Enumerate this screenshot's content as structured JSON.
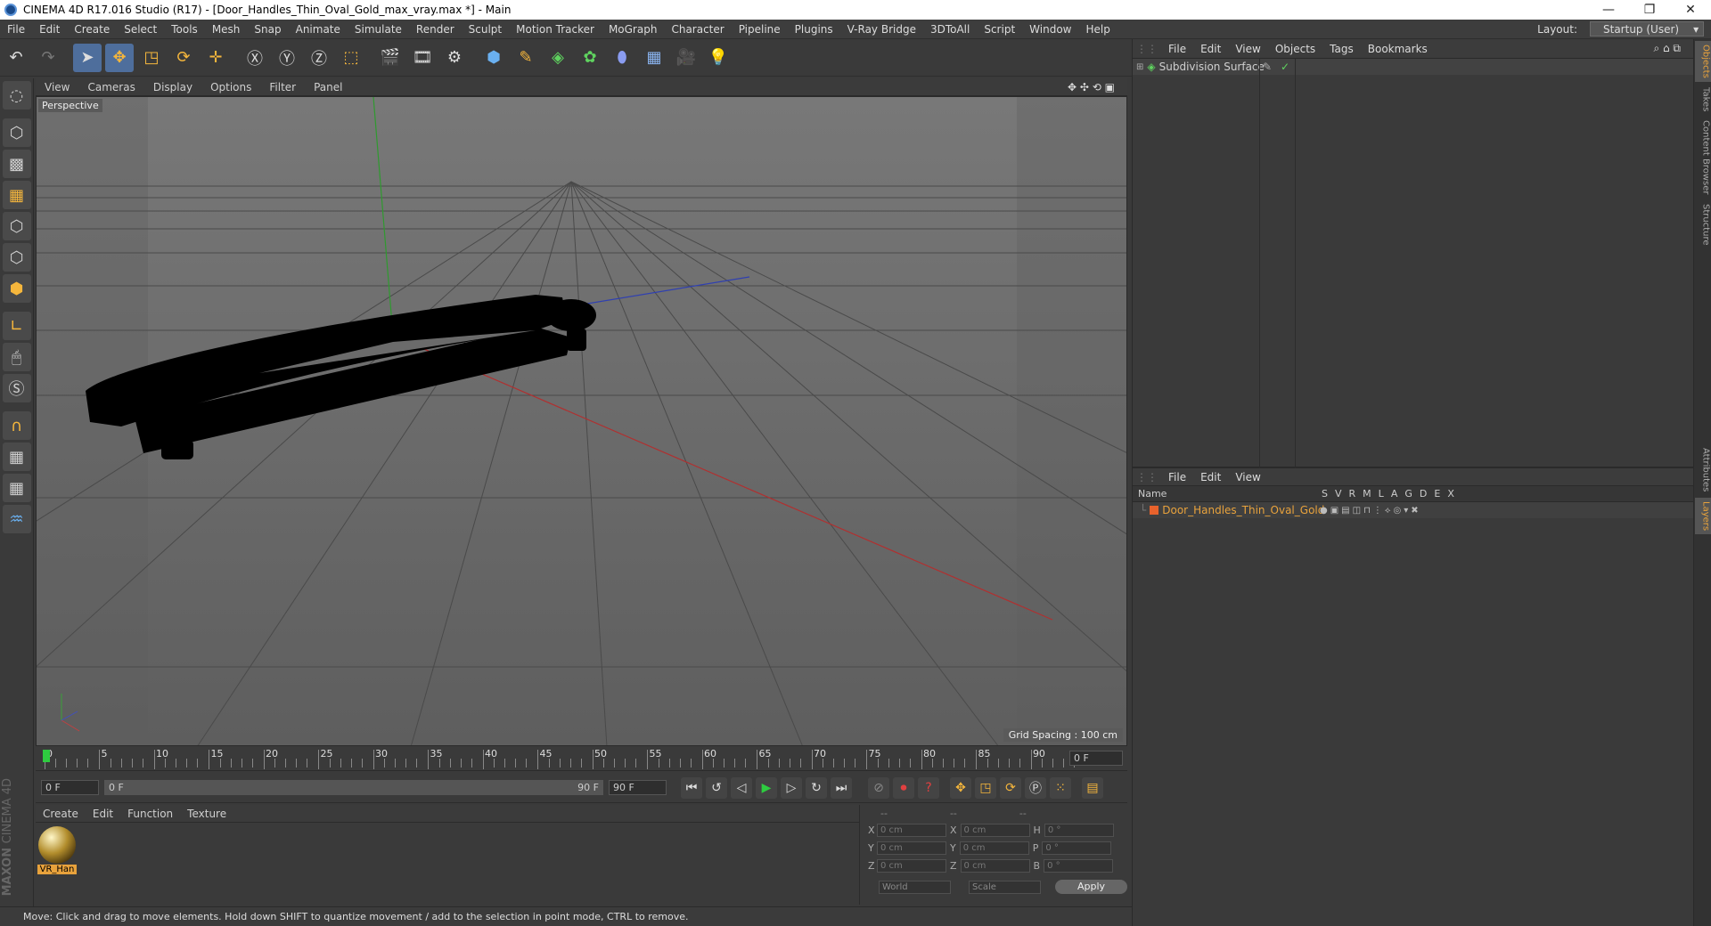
{
  "window": {
    "title": "CINEMA 4D R17.016 Studio (R17) - [Door_Handles_Thin_Oval_Gold_max_vray.max *] - Main"
  },
  "menu": {
    "items": [
      "File",
      "Edit",
      "Create",
      "Select",
      "Tools",
      "Mesh",
      "Snap",
      "Animate",
      "Simulate",
      "Render",
      "Sculpt",
      "Motion Tracker",
      "MoGraph",
      "Character",
      "Pipeline",
      "Plugins",
      "V-Ray Bridge",
      "3DToAll",
      "Script",
      "Window",
      "Help"
    ],
    "layout_label": "Layout:",
    "layout_value": "Startup (User)"
  },
  "viewport": {
    "menu": [
      "View",
      "Cameras",
      "Display",
      "Options",
      "Filter",
      "Panel"
    ],
    "camera_label": "Perspective",
    "grid_spacing": "Grid Spacing : 100 cm"
  },
  "timeline": {
    "ticks": [
      "0",
      "5",
      "10",
      "15",
      "20",
      "25",
      "30",
      "35",
      "40",
      "45",
      "50",
      "55",
      "60",
      "65",
      "70",
      "75",
      "80",
      "85",
      "90"
    ],
    "current_frame": "0 F",
    "start_field": "0 F",
    "range_start": "0 F",
    "range_end": "90 F",
    "end_field": "90 F"
  },
  "material_panel": {
    "menu": [
      "Create",
      "Edit",
      "Function",
      "Texture"
    ],
    "materials": [
      {
        "name": "VR_Han"
      }
    ]
  },
  "coords": {
    "headers": [
      "--",
      "--",
      "--"
    ],
    "rows": [
      {
        "a": "X",
        "v1": "0 cm",
        "b": "X",
        "v2": "0 cm",
        "c": "H",
        "v3": "0 °"
      },
      {
        "a": "Y",
        "v1": "0 cm",
        "b": "Y",
        "v2": "0 cm",
        "c": "P",
        "v3": "0 °"
      },
      {
        "a": "Z",
        "v1": "0 cm",
        "b": "Z",
        "v2": "0 cm",
        "c": "B",
        "v3": "0 °"
      }
    ],
    "mode_world": "World",
    "mode_scale": "Scale",
    "apply": "Apply"
  },
  "status": {
    "text": "Move: Click and drag to move elements. Hold down SHIFT to quantize movement / add to the selection in point mode, CTRL to remove."
  },
  "objects_panel": {
    "menu": [
      "File",
      "Edit",
      "View",
      "Objects",
      "Tags",
      "Bookmarks"
    ],
    "items": [
      {
        "name": "Subdivision Surface"
      }
    ]
  },
  "layers_panel": {
    "menu": [
      "File",
      "Edit",
      "View"
    ],
    "columns": {
      "name": "Name",
      "flags": [
        "S",
        "V",
        "R",
        "M",
        "L",
        "A",
        "G",
        "D",
        "E",
        "X"
      ]
    },
    "rows": [
      {
        "name": "Door_Handles_Thin_Oval_Gold"
      }
    ]
  },
  "side_tabs": [
    "Objects",
    "Takes",
    "Content Browser",
    "Structure"
  ],
  "side_tabs2": [
    "Attributes",
    "Layers"
  ],
  "brand": {
    "line1": "MAXON",
    "line2": "CINEMA 4D"
  }
}
